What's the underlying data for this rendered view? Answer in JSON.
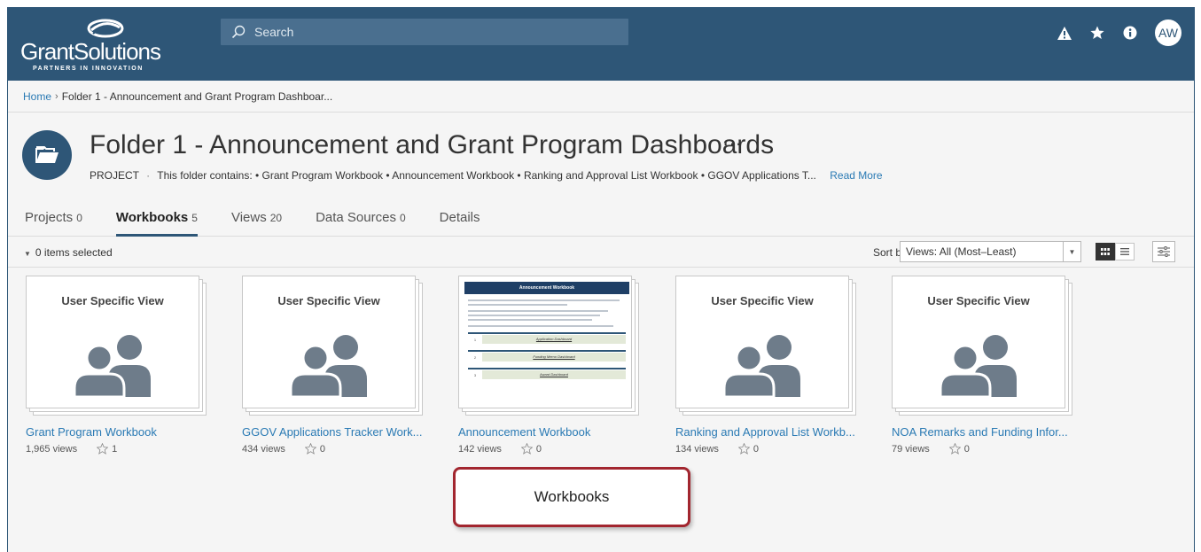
{
  "header": {
    "logo_text": "GrantSolutions",
    "logo_tagline": "PARTNERS IN INNOVATION",
    "search_placeholder": "Search",
    "avatar_initials": "AW",
    "bg_color": "#2e5677"
  },
  "breadcrumb": {
    "home": "Home",
    "separator": "›",
    "current": "Folder 1 - Announcement and Grant Program Dashboar..."
  },
  "project": {
    "title": "Folder 1 - Announcement and Grant Program Dashboards",
    "more": "···",
    "type": "PROJECT",
    "dot": "·",
    "description": "This folder contains: • Grant Program Workbook • Announcement Workbook • Ranking and Approval List Workbook • GGOV Applications T...",
    "read_more": "Read More"
  },
  "tabs": [
    {
      "label": "Projects",
      "count": "0"
    },
    {
      "label": "Workbooks",
      "count": "5"
    },
    {
      "label": "Views",
      "count": "20"
    },
    {
      "label": "Data Sources",
      "count": "0"
    },
    {
      "label": "Details",
      "count": ""
    }
  ],
  "toolbar": {
    "selection": "0 items selected",
    "sort_label": "Sort by",
    "sort_value": "Views: All (Most–Least)"
  },
  "cards": [
    {
      "thumb_title": "User Specific View",
      "name": "Grant Program Workbook",
      "views": "1,965 views",
      "favorites": "1"
    },
    {
      "thumb_title": "User Specific View",
      "name": "GGOV Applications Tracker Work...",
      "views": "434 views",
      "favorites": "0"
    },
    {
      "thumb_title": "",
      "name": "Announcement Workbook",
      "views": "142 views",
      "favorites": "0"
    },
    {
      "thumb_title": "User Specific View",
      "name": "Ranking and Approval List Workb...",
      "views": "134 views",
      "favorites": "0"
    },
    {
      "thumb_title": "User Specific View",
      "name": "NOA Remarks and Funding Infor...",
      "views": "79 views",
      "favorites": "0"
    }
  ],
  "announcement_thumb": {
    "header": "Announcement Workbook",
    "rows": [
      "Application Dashboard",
      "Funding Memo Dashboard",
      "Award Dashboard"
    ],
    "row_numbers": [
      "1",
      "2",
      "3"
    ]
  },
  "callout": {
    "label": "Workbooks",
    "border_color": "#a2262f"
  }
}
